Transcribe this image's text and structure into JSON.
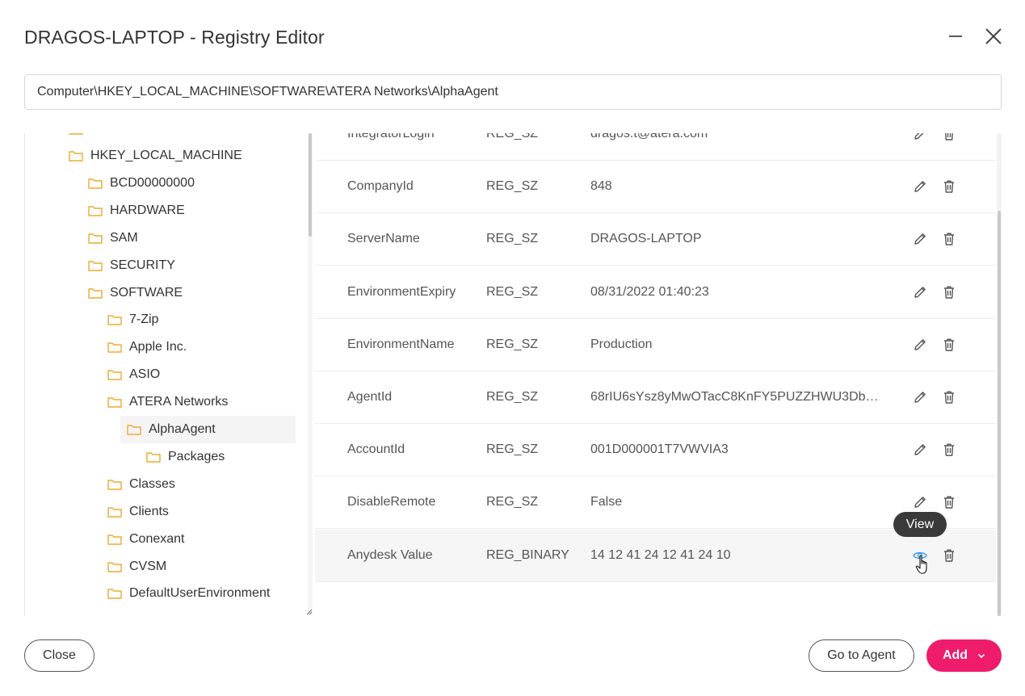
{
  "window": {
    "title": "DRAGOS-LAPTOP - Registry Editor"
  },
  "path": "Computer\\HKEY_LOCAL_MACHINE\\SOFTWARE\\ATERA Networks\\AlphaAgent",
  "tree": {
    "items": [
      {
        "label": "HKEY_LOCAL_MACHINE",
        "depth": 0,
        "selected": false
      },
      {
        "label": "BCD00000000",
        "depth": 1,
        "selected": false
      },
      {
        "label": "HARDWARE",
        "depth": 1,
        "selected": false
      },
      {
        "label": "SAM",
        "depth": 1,
        "selected": false
      },
      {
        "label": "SECURITY",
        "depth": 1,
        "selected": false
      },
      {
        "label": "SOFTWARE",
        "depth": 1,
        "selected": false
      },
      {
        "label": "7-Zip",
        "depth": 2,
        "selected": false
      },
      {
        "label": "Apple Inc.",
        "depth": 2,
        "selected": false
      },
      {
        "label": "ASIO",
        "depth": 2,
        "selected": false
      },
      {
        "label": "ATERA Networks",
        "depth": 2,
        "selected": false
      },
      {
        "label": "AlphaAgent",
        "depth": 3,
        "selected": true
      },
      {
        "label": "Packages",
        "depth": 4,
        "selected": false
      },
      {
        "label": "Classes",
        "depth": 2,
        "selected": false
      },
      {
        "label": "Clients",
        "depth": 2,
        "selected": false
      },
      {
        "label": "Conexant",
        "depth": 2,
        "selected": false
      },
      {
        "label": "CVSM",
        "depth": 2,
        "selected": false
      },
      {
        "label": "DefaultUserEnvironment",
        "depth": 2,
        "selected": false
      }
    ]
  },
  "values": {
    "rows": [
      {
        "name": "IntegratorLogin",
        "type": "REG_SZ",
        "data": "dragos.t@atera.com"
      },
      {
        "name": "CompanyId",
        "type": "REG_SZ",
        "data": "848"
      },
      {
        "name": "ServerName",
        "type": "REG_SZ",
        "data": "DRAGOS-LAPTOP"
      },
      {
        "name": "EnvironmentExpiry",
        "type": "REG_SZ",
        "data": "08/31/2022 01:40:23"
      },
      {
        "name": "EnvironmentName",
        "type": "REG_SZ",
        "data": "Production"
      },
      {
        "name": "AgentId",
        "type": "REG_SZ",
        "data": "68rIU6sYsz8yMwOTacC8KnFY5PUZZHWU3Db…"
      },
      {
        "name": "AccountId",
        "type": "REG_SZ",
        "data": "001D000001T7VWVIA3"
      },
      {
        "name": "DisableRemote",
        "type": "REG_SZ",
        "data": "False"
      },
      {
        "name": "Anydesk Value",
        "type": "REG_BINARY",
        "data": "14 12 41 24 12 41 24 10"
      }
    ]
  },
  "tooltip": {
    "text": "View"
  },
  "footer": {
    "close_label": "Close",
    "go_to_agent_label": "Go to Agent",
    "add_label": "Add"
  },
  "colors": {
    "accent": "#ee1c6a",
    "folder": "#f0a92e",
    "view_icon": "#3d9be9"
  },
  "icons": {
    "minimize": "minimize-icon",
    "close": "close-icon",
    "folder": "folder-icon",
    "edit": "pencil-icon",
    "delete": "trash-icon",
    "view": "eye-icon",
    "dropdown": "chevron-down-icon"
  }
}
